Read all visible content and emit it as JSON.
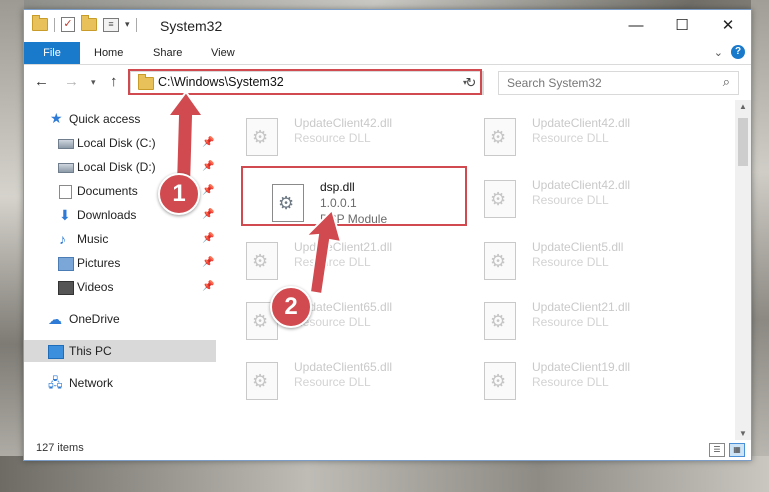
{
  "window": {
    "title": "System32"
  },
  "ribbon": {
    "tabs": [
      "File",
      "Home",
      "Share",
      "View"
    ]
  },
  "address": {
    "path": "C:\\Windows\\System32"
  },
  "search": {
    "placeholder": "Search System32"
  },
  "nav": {
    "items": [
      {
        "label": "Quick access"
      },
      {
        "label": "Local Disk (C:)"
      },
      {
        "label": "Local Disk (D:)"
      },
      {
        "label": "Documents"
      },
      {
        "label": "Downloads"
      },
      {
        "label": "Music"
      },
      {
        "label": "Pictures"
      },
      {
        "label": "Videos"
      },
      {
        "label": "OneDrive"
      },
      {
        "label": "This PC"
      },
      {
        "label": "Network"
      }
    ]
  },
  "files": {
    "bg": [
      {
        "name": "UpdateClient42.dll",
        "desc": "Resource DLL"
      },
      {
        "name": "UpdateClient42.dll",
        "desc": "Resource DLL"
      },
      {
        "name": "UpdateClient42.dll",
        "desc": "Resource DLL"
      },
      {
        "name": "UpdateClient21.dll",
        "desc": "Resource DLL"
      },
      {
        "name": "UpdateClient5.dll",
        "desc": "Resource DLL"
      },
      {
        "name": "UpdateClient65.dll",
        "desc": "Resource DLL"
      },
      {
        "name": "UpdateClient21.dll",
        "desc": "Resource DLL"
      },
      {
        "name": "UpdateClient65.dll",
        "desc": "Resource DLL"
      },
      {
        "name": "UpdateClient19.dll",
        "desc": "Resource DLL"
      }
    ],
    "selected": {
      "name": "dsp.dll",
      "version": "1.0.0.1",
      "desc": "DSP Module"
    }
  },
  "status": {
    "items": "127 items"
  },
  "callouts": {
    "one": "1",
    "two": "2"
  },
  "colors": {
    "accent": "#1979ca",
    "highlight": "#d04a4f"
  }
}
